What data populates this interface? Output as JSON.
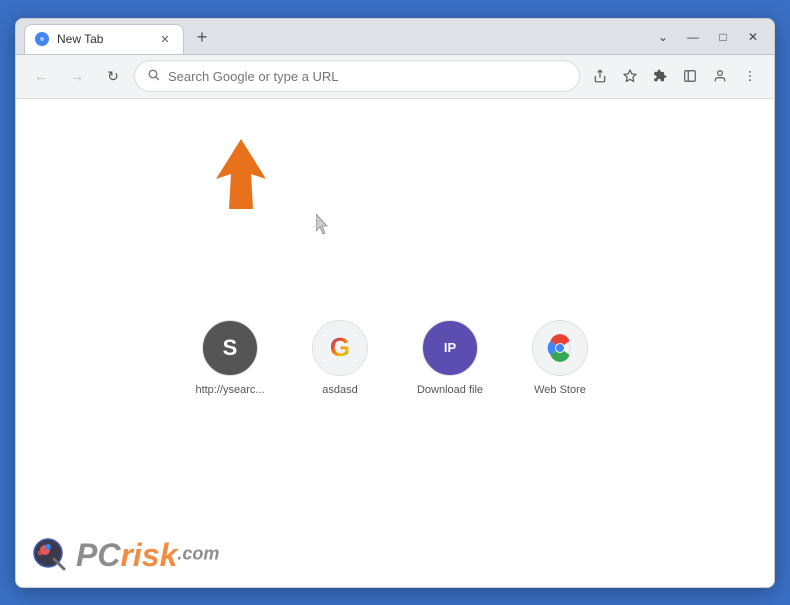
{
  "browser": {
    "tab": {
      "title": "New Tab",
      "favicon_label": "chrome-favicon"
    },
    "new_tab_button": "+",
    "window_controls": {
      "minimize": "—",
      "maximize": "□",
      "close": "✕",
      "collapse": "⌄"
    },
    "toolbar": {
      "back_label": "←",
      "forward_label": "→",
      "reload_label": "↻",
      "address_placeholder": "Search Google or type a URL",
      "share_icon": "⬆",
      "bookmark_icon": "☆",
      "extension_icon": "⬡",
      "sidebar_icon": "▣",
      "profile_icon": "◉",
      "menu_icon": "⋮"
    }
  },
  "shortcuts": [
    {
      "id": "ysearch",
      "label": "http://ysearc...",
      "icon_type": "s",
      "icon_char": "S"
    },
    {
      "id": "asdasd",
      "label": "asdasd",
      "icon_type": "google",
      "icon_char": "G"
    },
    {
      "id": "download",
      "label": "Download file",
      "icon_type": "ip",
      "icon_char": "IP"
    },
    {
      "id": "webstore",
      "label": "Web Store",
      "icon_type": "webstore",
      "icon_char": "🌈"
    }
  ],
  "watermark": {
    "pc": "PC",
    "risk": "risk",
    "com": ".com"
  },
  "annotation": {
    "arrow_color": "#e8721c"
  }
}
